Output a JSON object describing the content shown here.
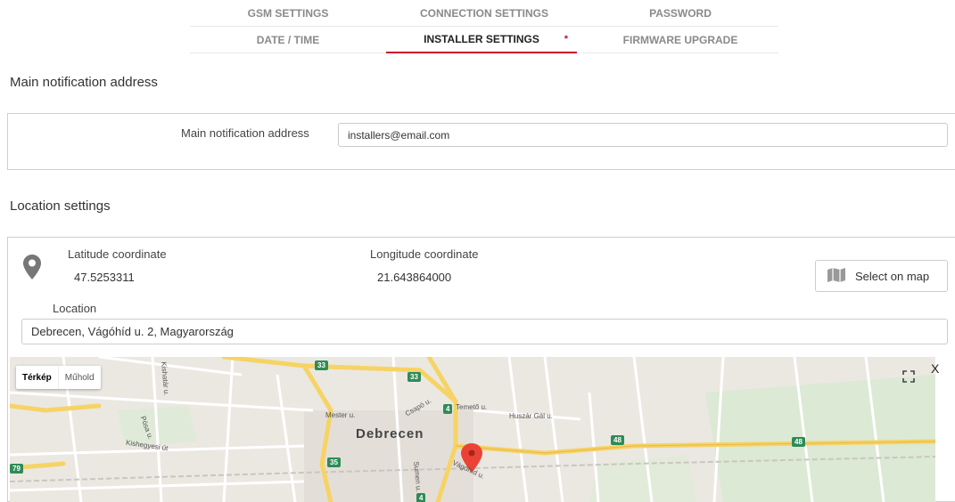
{
  "tabs": {
    "row1": [
      "GSM SETTINGS",
      "CONNECTION SETTINGS",
      "PASSWORD"
    ],
    "row2": [
      "DATE / TIME",
      "INSTALLER SETTINGS",
      "FIRMWARE UPGRADE"
    ],
    "active": "INSTALLER SETTINGS",
    "modified_mark": "*"
  },
  "notification": {
    "section_title": "Main notification address",
    "field_label": "Main notification address",
    "value": "installers@email.com"
  },
  "location": {
    "section_title": "Location settings",
    "latitude_label": "Latitude coordinate",
    "latitude_value": "47.5253311",
    "longitude_label": "Longitude coordinate",
    "longitude_value": "21.643864000",
    "select_on_map_label": "Select on map",
    "location_label": "Location",
    "location_value": "Debrecen, Vágóhíd u. 2, Magyarország"
  },
  "map": {
    "type_map": "Térkép",
    "type_satellite": "Műhold",
    "city_label": "Debrecen",
    "close_label": "X",
    "street_labels": [
      "Mester u.",
      "Csapó u.",
      "Temető u.",
      "Huszár Gál u.",
      "Kishegyesi út",
      "Vágóhíd u.",
      "Sumen u.",
      "Pósa u.",
      "Kishatár u."
    ],
    "road_numbers": [
      "33",
      "33",
      "4",
      "35",
      "4",
      "48",
      "48",
      "79"
    ],
    "accent_color": "#c8102e"
  }
}
